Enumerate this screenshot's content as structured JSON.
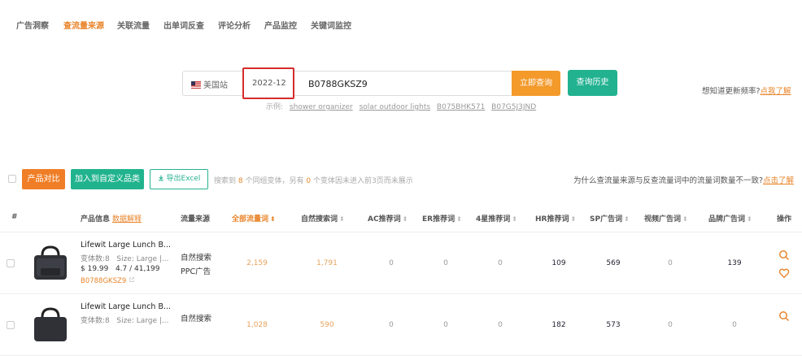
{
  "nav": {
    "tabs": [
      "广告洞察",
      "查流量来源",
      "关联流量",
      "出单词反查",
      "评论分析",
      "产品监控",
      "关键词监控"
    ],
    "active": "查流量来源"
  },
  "search": {
    "site": "美国站",
    "date": "2022-12",
    "asin": "B0788GKSZ9",
    "query_btn": "立即查询",
    "history_btn": "查询历史",
    "freq_q": "想知道更新频率?",
    "freq_link": "点我了解",
    "examples_label": "示例:",
    "examples": [
      "shower organizer",
      "solar outdoor lights",
      "B075BHK571",
      "B07G5J3JND"
    ]
  },
  "toolbar": {
    "compare_btn": "产品对比",
    "add_btn": "加入到自定义品类",
    "excel_btn": "导出Excel",
    "note_a": "搜索到",
    "variant_count": "8",
    "note_b": "个同组变体，另有",
    "missing_count": "0",
    "note_c": "个变体因未进入前3页而未展示",
    "why_q": "为什么查流量来源与反查流量词中的流量词数量不一致?",
    "why_link": "点击了解"
  },
  "table": {
    "headers": {
      "index": "#",
      "product": "产品信息",
      "explain": "数据解释",
      "source": "流量来源",
      "all": "全部流量词",
      "natural": "自然搜索词",
      "ac": "AC推荐词",
      "er": "ER推荐词",
      "star4": "4星推荐词",
      "hr": "HR推荐词",
      "sp": "SP广告词",
      "video": "视频广告词",
      "brand": "品牌广告词",
      "ops": "操作"
    },
    "rows": [
      {
        "title": "Lifewit Large Lunch B...",
        "variants": "变体数:8",
        "size": "Size: Large |...",
        "price": "$ 19.99",
        "rating": "4.7 / 41,199",
        "asin": "B0788GKSZ9",
        "sources": [
          "自然搜索",
          "PPC广告"
        ],
        "all": "2,159",
        "natural": "1,791",
        "ac": "0",
        "er": "0",
        "star4": "0",
        "hr": "109",
        "sp": "569",
        "video": "0",
        "brand": "139"
      },
      {
        "title": "Lifewit Large Lunch B...",
        "variants": "变体数:8",
        "size": "Size: Large |...",
        "sources": [
          "自然搜索"
        ],
        "all": "1,028",
        "natural": "590",
        "ac": "0",
        "er": "0",
        "star4": "0",
        "hr": "182",
        "sp": "573",
        "video": "0",
        "brand": "0"
      }
    ]
  },
  "colors": {
    "accent": "#e8842a",
    "green": "#22b290",
    "highlight": "#d62b2b"
  },
  "icons": [
    "search-icon",
    "heart-icon",
    "download-icon",
    "external-link-icon",
    "sort-icon",
    "us-flag-icon"
  ]
}
